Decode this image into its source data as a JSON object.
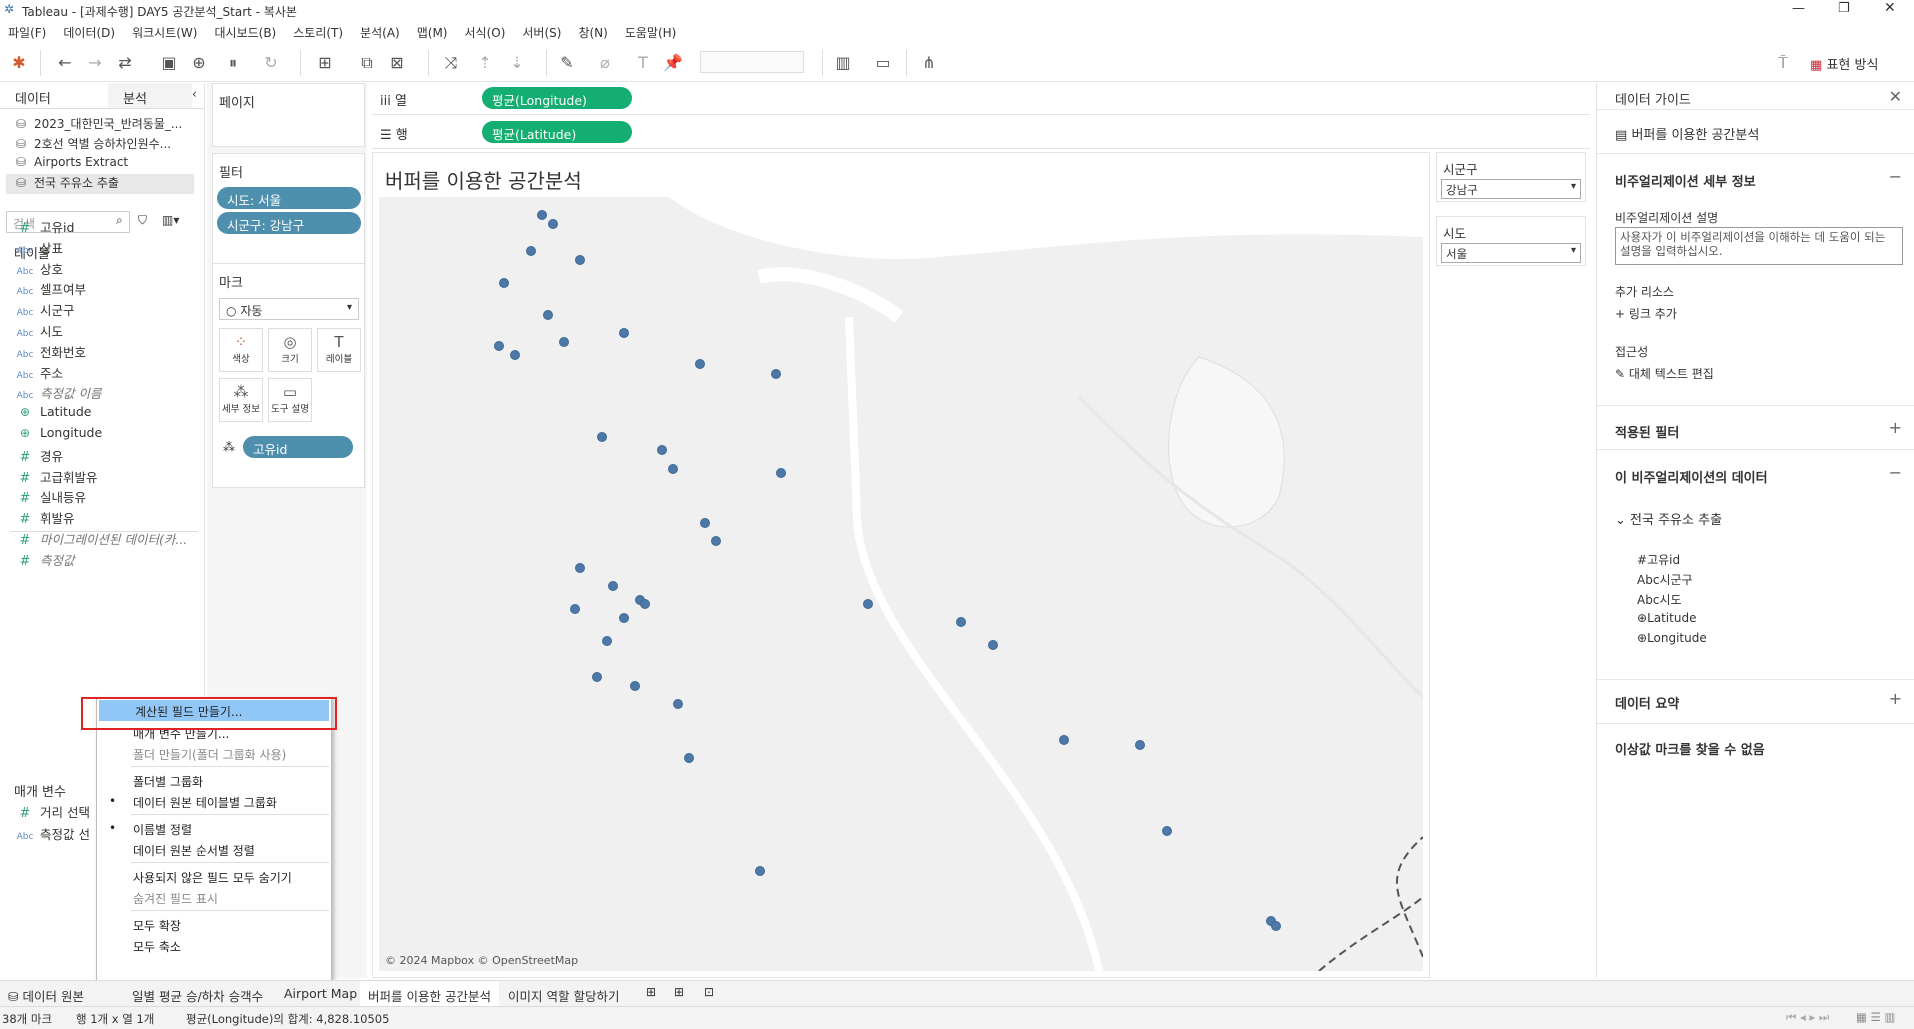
{
  "window": {
    "title": "Tableau - [과제수행] DAY5 공간분석_Start - 복사본"
  },
  "menu": [
    "파일(F)",
    "데이터(D)",
    "워크시트(W)",
    "대시보드(B)",
    "스토리(T)",
    "분석(A)",
    "맵(M)",
    "서식(O)",
    "서버(S)",
    "창(N)",
    "도움말(H)"
  ],
  "toolbar": {
    "show_me": "표현 방식"
  },
  "left": {
    "tabs": [
      "데이터",
      "분석"
    ],
    "datasources": [
      "2023_대한민국_반려동물_...",
      "2호선 역별 승하차인원수...",
      "Airports Extract",
      "전국 주유소 추출"
    ],
    "search_placeholder": "검색",
    "tables_header": "테이블",
    "fields": [
      {
        "t": "#",
        "name": "고유id"
      },
      {
        "t": "Abc",
        "name": "상표"
      },
      {
        "t": "Abc",
        "name": "상호"
      },
      {
        "t": "Abc",
        "name": "셀프여부"
      },
      {
        "t": "Abc",
        "name": "시군구"
      },
      {
        "t": "Abc",
        "name": "시도"
      },
      {
        "t": "Abc",
        "name": "전화번호"
      },
      {
        "t": "Abc",
        "name": "주소"
      },
      {
        "t": "Abc",
        "name": "측정값 이름"
      },
      {
        "t": "geo",
        "name": "Latitude"
      },
      {
        "t": "geo",
        "name": "Longitude"
      },
      {
        "t": "#",
        "name": "경유"
      },
      {
        "t": "#",
        "name": "고급휘발유"
      },
      {
        "t": "#",
        "name": "실내등유"
      },
      {
        "t": "#",
        "name": "휘발유"
      },
      {
        "t": "#",
        "name": "마이그레이션된 데이터(카..."
      },
      {
        "t": "#",
        "name": "측정값"
      }
    ],
    "params_header": "매개 변수",
    "params": [
      {
        "t": "#",
        "name": "거리 선택"
      },
      {
        "t": "Abc",
        "name": "측정값 선"
      }
    ]
  },
  "mid": {
    "pages": "페이지",
    "filters": "필터",
    "filter_pills": [
      "시도: 서울",
      "시군구: 강남구"
    ],
    "marks": "마크",
    "mark_type": "자동",
    "mark_buttons": [
      "색상",
      "크기",
      "레이블",
      "세부 정보",
      "도구 설명"
    ],
    "detail_pill": "고유id"
  },
  "shelves": {
    "columns_label": "열",
    "columns_pill": "평균(Longitude)",
    "rows_label": "행",
    "rows_pill": "평균(Latitude)"
  },
  "sheet": {
    "title": "버퍼를 이용한 공간분석",
    "credit": "© 2024 Mapbox © OpenStreetMap",
    "points": [
      [
        2.2,
        48.7
      ],
      [
        2.22,
        48.68
      ],
      [
        2.18,
        48.62
      ],
      [
        2.27,
        48.6
      ],
      [
        2.13,
        48.55
      ],
      [
        2.21,
        48.48
      ],
      [
        2.35,
        48.44
      ],
      [
        2.12,
        48.41
      ],
      [
        2.15,
        48.39
      ],
      [
        2.24,
        48.42
      ],
      [
        2.49,
        48.37
      ],
      [
        2.63,
        48.35
      ],
      [
        2.31,
        48.21
      ],
      [
        2.42,
        48.18
      ],
      [
        2.44,
        48.14
      ],
      [
        2.64,
        48.13
      ],
      [
        2.5,
        48.02
      ],
      [
        2.52,
        47.98
      ],
      [
        2.27,
        47.92
      ],
      [
        2.33,
        47.88
      ],
      [
        2.38,
        47.85
      ],
      [
        2.39,
        47.84
      ],
      [
        2.26,
        47.83
      ],
      [
        2.35,
        47.81
      ],
      [
        2.8,
        47.84
      ],
      [
        2.97,
        47.8
      ],
      [
        3.03,
        47.75
      ],
      [
        2.32,
        47.76
      ],
      [
        2.3,
        47.68
      ],
      [
        2.37,
        47.66
      ],
      [
        2.45,
        47.62
      ],
      [
        3.16,
        47.54
      ],
      [
        3.3,
        47.53
      ],
      [
        2.47,
        47.5
      ],
      [
        3.35,
        47.34
      ],
      [
        2.6,
        47.25
      ],
      [
        3.54,
        47.14
      ],
      [
        3.55,
        47.13
      ]
    ],
    "xrange": [
      1.9,
      3.82
    ],
    "yrange": [
      47.03,
      48.74
    ]
  },
  "filter_cards": [
    {
      "label": "시군구",
      "value": "강남구"
    },
    {
      "label": "시도",
      "value": "서울"
    }
  ],
  "right": {
    "header": "데이터 가이드",
    "sheet_name": "버퍼를 이용한 공간분석",
    "viz_details": "비주얼리제이션 세부 정보",
    "viz_desc_label": "비주얼리제이션 설명",
    "viz_desc_placeholder": "사용자가 이 비주얼리제이션을 이해하는 데 도움이 되는 설명을 입력하십시오.",
    "extra_resources": "추가 리소스",
    "add_link": "링크 추가",
    "accessibility": "접근성",
    "edit_alt": "대체 텍스트 편집",
    "applied_filters": "적용된 필터",
    "data_in_viz": "이 비주얼리제이션의 데이터",
    "ds_name": "전국 주유소 추출",
    "ds_fields": [
      {
        "t": "#",
        "name": "고유id"
      },
      {
        "t": "Abc",
        "name": "시군구"
      },
      {
        "t": "Abc",
        "name": "시도"
      },
      {
        "t": "geo",
        "name": "Latitude"
      },
      {
        "t": "geo",
        "name": "Longitude"
      }
    ],
    "data_summary": "데이터 요약",
    "no_outliers": "이상값 마크를 찾을 수 없음"
  },
  "context_menu": [
    {
      "label": "계산된 필드 만들기...",
      "state": "hl"
    },
    {
      "label": "매개 변수 만들기...",
      "state": ""
    },
    {
      "label": "폴더 만들기(폴더 그룹화 사용)",
      "state": "dis"
    },
    {
      "label": "폴더별 그룹화",
      "state": ""
    },
    {
      "label": "데이터 원본 테이블별 그룹화",
      "state": "bullet"
    },
    {
      "label": "이름별 정렬",
      "state": "bullet"
    },
    {
      "label": "데이터 원본 순서별 정렬",
      "state": ""
    },
    {
      "label": "사용되지 않은 필드 모두 숨기기",
      "state": ""
    },
    {
      "label": "숨겨진 필드 표시",
      "state": "dis"
    },
    {
      "label": "모두 확장",
      "state": ""
    },
    {
      "label": "모두 축소",
      "state": ""
    }
  ],
  "sheet_tabs": [
    "데이터 원본",
    "일별 평균 승/하차 승객수",
    "Airport Map",
    "버퍼를 이용한 공간분석",
    "이미지 역할 할당하기"
  ],
  "status": {
    "marks": "38개 마크",
    "rows_cols": "행 1개 x 열 1개",
    "sum": "평균(Longitude)의 합계: 4,828.10505"
  },
  "colors": {
    "pill_blue": "#4e8fad",
    "pill_green": "#14ae72",
    "mark": "#4e79a7",
    "highlight": "#91c7f7",
    "redbox": "#e02424"
  }
}
